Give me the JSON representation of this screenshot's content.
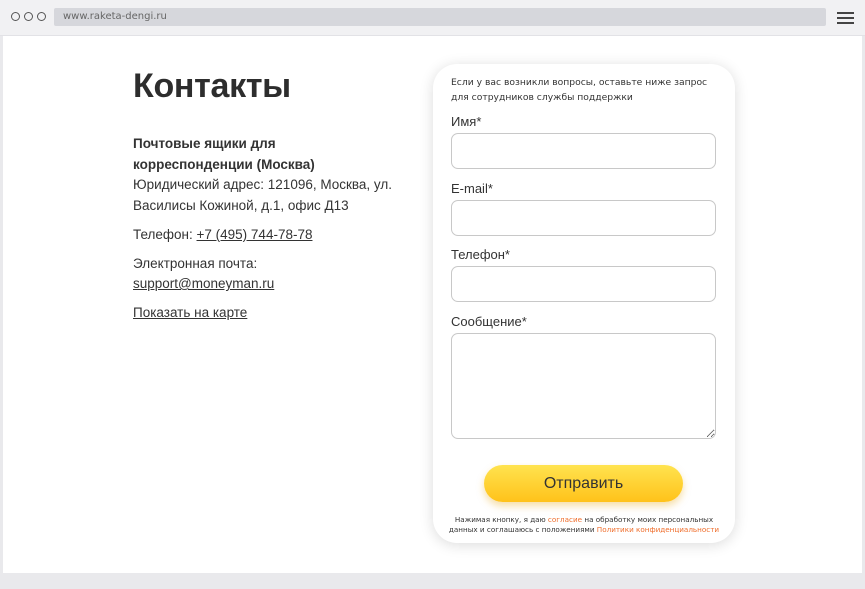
{
  "browser": {
    "url": "www.raketa-dengi.ru"
  },
  "contacts": {
    "title": "Контакты",
    "address_heading": "Почтовые ящики для корреспонденции (Москва)",
    "address_text": "Юридический адрес: 121096, Москва, ул. Василисы Кожиной, д.1, офис Д13",
    "phone_label": "Телефон: ",
    "phone_value": "+7 (495) 744-78-78",
    "email_label": "Электронная почта:",
    "email_value": "support@moneyman.ru",
    "map_link": "Показать на карте"
  },
  "form": {
    "intro": "Если у вас возникли вопросы, оставьте ниже запрос для сотрудников службы поддержки",
    "name_label": "Имя*",
    "name_value": "",
    "email_label": "E-mail*",
    "email_value": "",
    "phone_label": "Телефон*",
    "phone_value": "",
    "message_label": "Сообщение*",
    "message_value": "",
    "submit_label": "Отправить",
    "legal_prefix": "Нажимая кнопку, я даю ",
    "legal_link1": "согласие",
    "legal_middle": " на обработку моих персональных данных и соглашаюсь с положениями ",
    "legal_link2": "Политики конфиденциальности",
    "accent_color": "#ef6d2b",
    "button_color": "#ffd230"
  }
}
